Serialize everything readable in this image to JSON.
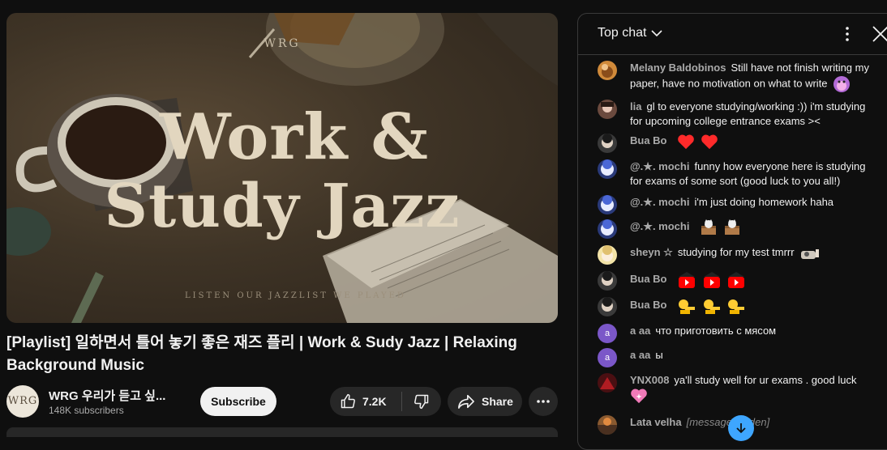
{
  "thumbnail": {
    "brand": "WRG",
    "line1": "Work &",
    "line2": "Study Jazz",
    "subtitle": "LISTEN OUR JAZZLIST WE PLAYED"
  },
  "video": {
    "title": "[Playlist] 일하면서 틀어 놓기 좋은 재즈 플리 | Work & Sudy Jazz | Relaxing Background Music"
  },
  "channel": {
    "avatar_text": "WRG",
    "name": "WRG 우리가 듣고 싶...",
    "subscribers": "148K subscribers",
    "subscribe_label": "Subscribe"
  },
  "actions": {
    "like_count": "7.2K",
    "share_label": "Share"
  },
  "chat": {
    "mode": "Top chat",
    "messages": [
      {
        "author": "Melany Baldobinos",
        "text": "Still have not finish writing my paper, have no motivation on what to write",
        "emoji": [
          "face-emoji"
        ]
      },
      {
        "author": "lia",
        "text": "gl to everyone studying/working :)) i'm studying for upcoming college entrance exams ><",
        "emoji": []
      },
      {
        "author": "Bua Bo",
        "text": "",
        "emoji": [
          "heart",
          "heart"
        ]
      },
      {
        "author": "@.★. mochi",
        "text": "funny how everyone here is studying for exams of some sort (good luck to you all!)",
        "emoji": []
      },
      {
        "author": "@.★. mochi",
        "text": "i'm just doing homework haha",
        "emoji": []
      },
      {
        "author": "@.★. mochi",
        "text": "",
        "emoji": [
          "cat-box",
          "cat-box"
        ]
      },
      {
        "author": "sheyn ☆",
        "text": "studying for my test tmrrr",
        "emoji": [
          "study-emoji"
        ]
      },
      {
        "author": "Bua Bo",
        "text": "",
        "emoji": [
          "yt-play",
          "yt-play",
          "yt-play"
        ]
      },
      {
        "author": "Bua Bo",
        "text": "",
        "emoji": [
          "pointing-hand",
          "pointing-hand",
          "pointing-hand"
        ]
      },
      {
        "author": "a aa",
        "avatar_letter": "a",
        "text": "что приготовить с мясом",
        "emoji": []
      },
      {
        "author": "a aa",
        "avatar_letter": "a",
        "text": "ы",
        "emoji": []
      },
      {
        "author": "YNX008",
        "text": "ya'll study well for ur exams . good luck",
        "emoji": [
          "sparkle-heart"
        ]
      },
      {
        "author": "Lata velha",
        "text": "[message hidden]",
        "emoji": []
      }
    ]
  },
  "colors": {
    "background": "#0f0f0f",
    "accent_blue": "#3ea6ff",
    "pill": "#272727",
    "heart_red": "#ff2a2a",
    "yt_red": "#ff0000"
  }
}
